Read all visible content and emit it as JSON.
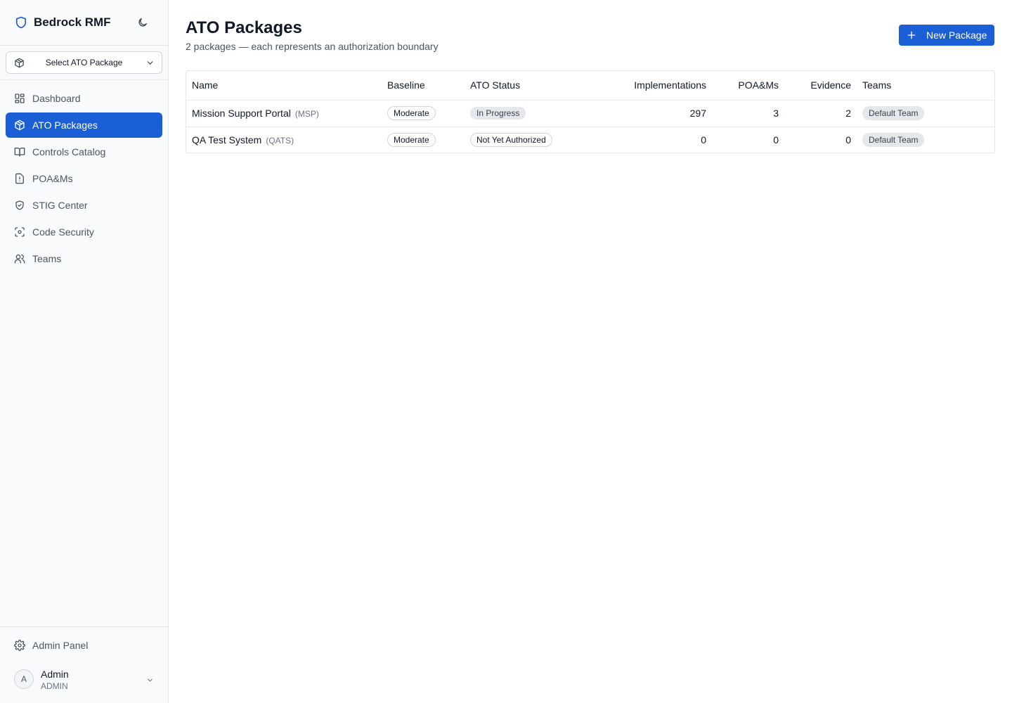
{
  "app": {
    "title": "Bedrock RMF",
    "theme_toggle_icon": "moon-icon"
  },
  "package_selector": {
    "label": "Select ATO Package",
    "icon": "package-icon"
  },
  "sidebar": {
    "items": [
      {
        "label": "Dashboard",
        "icon": "dashboard-icon",
        "active": false
      },
      {
        "label": "ATO Packages",
        "icon": "package-icon",
        "active": true
      },
      {
        "label": "Controls Catalog",
        "icon": "book-icon",
        "active": false
      },
      {
        "label": "POA&Ms",
        "icon": "file-alert-icon",
        "active": false
      },
      {
        "label": "STIG Center",
        "icon": "shield-check-icon",
        "active": false
      },
      {
        "label": "Code Security",
        "icon": "scan-icon",
        "active": false
      },
      {
        "label": "Teams",
        "icon": "users-icon",
        "active": false
      }
    ],
    "admin_panel": "Admin Panel",
    "user": {
      "initial": "A",
      "name": "Admin",
      "role": "ADMIN"
    }
  },
  "main": {
    "title": "ATO Packages",
    "subtitle": "2 packages — each represents an authorization boundary",
    "new_button": "New Package",
    "table": {
      "headers": [
        "Name",
        "Baseline",
        "ATO Status",
        "Implementations",
        "POA&Ms",
        "Evidence",
        "Teams"
      ],
      "rows": [
        {
          "name": "Mission Support Portal",
          "code": "(MSP)",
          "baseline": "Moderate",
          "status": "In Progress",
          "implementations": "297",
          "poams": "3",
          "evidence": "2",
          "team": "Default Team"
        },
        {
          "name": "QA Test System",
          "code": "(QATS)",
          "baseline": "Moderate",
          "status": "Not Yet Authorized",
          "implementations": "0",
          "poams": "0",
          "evidence": "0",
          "team": "Default Team"
        }
      ]
    }
  },
  "colors": {
    "accent": "#1a5fd6",
    "sidebar_bg": "#f9fafb",
    "border": "#e5e7eb"
  }
}
